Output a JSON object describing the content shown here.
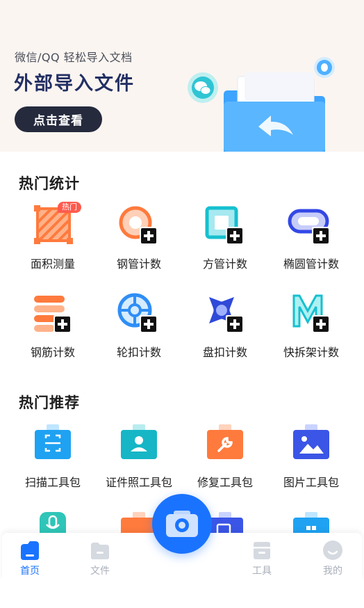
{
  "banner": {
    "subtitle": "微信/QQ 轻松导入文档",
    "title": "外部导入文件",
    "button_label": "点击查看"
  },
  "hot_stats": {
    "title": "热门统计",
    "badge": "热门",
    "items": [
      {
        "label": "面积测量",
        "icon": "area-measure-icon"
      },
      {
        "label": "钢管计数",
        "icon": "steel-pipe-count-icon"
      },
      {
        "label": "方管计数",
        "icon": "square-pipe-count-icon"
      },
      {
        "label": "椭圆管计数",
        "icon": "oval-pipe-count-icon"
      },
      {
        "label": "钢筋计数",
        "icon": "rebar-count-icon"
      },
      {
        "label": "轮扣计数",
        "icon": "wheel-buckle-count-icon"
      },
      {
        "label": "盘扣计数",
        "icon": "disc-buckle-count-icon"
      },
      {
        "label": "快拆架计数",
        "icon": "quick-frame-count-icon"
      }
    ]
  },
  "recommend": {
    "title": "热门推荐",
    "items": [
      {
        "label": "扫描工具包",
        "icon": "scan-toolkit-icon"
      },
      {
        "label": "证件照工具包",
        "icon": "id-photo-toolkit-icon"
      },
      {
        "label": "修复工具包",
        "icon": "repair-toolkit-icon"
      },
      {
        "label": "图片工具包",
        "icon": "image-toolkit-icon"
      }
    ]
  },
  "nav": {
    "home": "首页",
    "files": "文件",
    "tools": "工具",
    "mine": "我的"
  },
  "colors": {
    "accent": "#1a73ff",
    "orange": "#ff7a3d",
    "navy": "#243064"
  }
}
